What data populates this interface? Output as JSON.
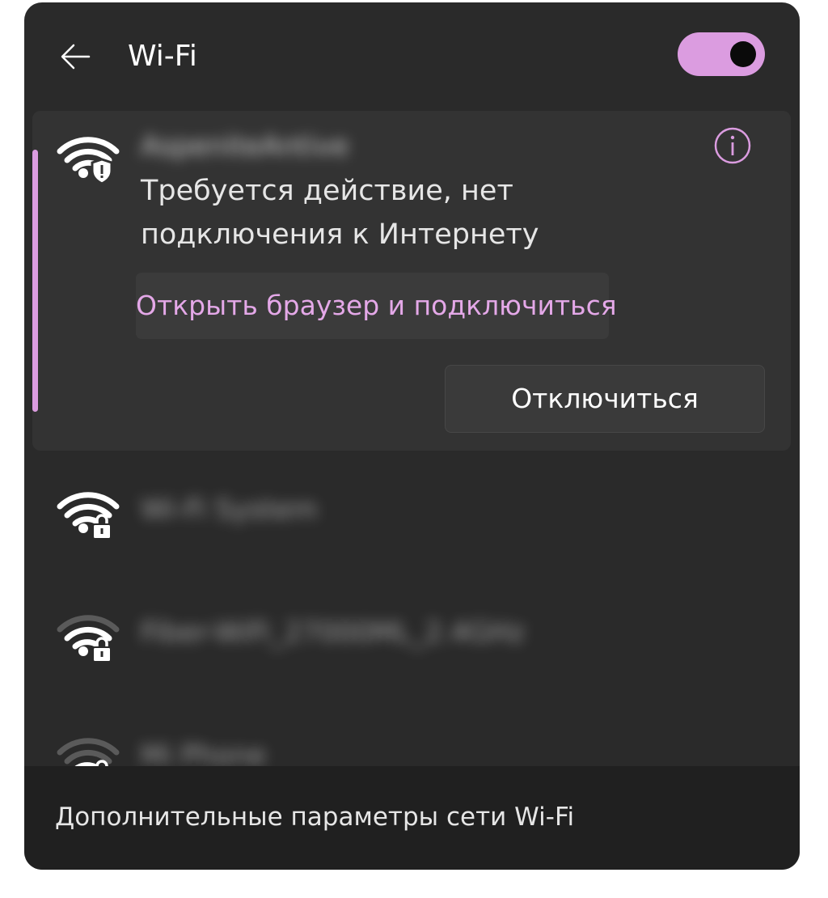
{
  "header": {
    "back_icon": "arrow-left-icon",
    "title": "Wi-Fi",
    "toggle_state": "on",
    "accent_color": "#db9ce0"
  },
  "connected_network": {
    "ssid": "AspeniteAntive",
    "status": "Требуется действие, нет подключения к Интернету",
    "open_browser_label": "Открыть браузер и подключиться",
    "disconnect_label": "Отключиться",
    "icon": "wifi-secured-warning-icon",
    "info_icon": "info-icon"
  },
  "networks": [
    {
      "ssid": "Wi-Fi System",
      "icon": "wifi-locked-icon",
      "signal": "strong"
    },
    {
      "ssid": "Fiber-WiFi_27000ML_2.4GHz",
      "icon": "wifi-locked-icon",
      "signal": "medium"
    },
    {
      "ssid": "Mi Phone",
      "icon": "wifi-locked-icon",
      "signal": "weak"
    }
  ],
  "footer": {
    "label": "Дополнительные параметры сети Wi-Fi"
  }
}
